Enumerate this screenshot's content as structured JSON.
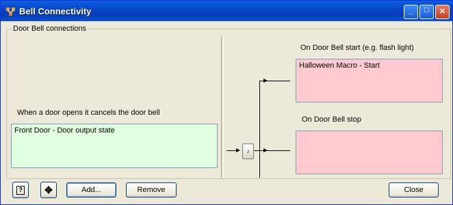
{
  "window": {
    "title": "Bell Connectivity",
    "minimize_glyph": "_",
    "maximize_glyph": "□",
    "close_glyph": "✕"
  },
  "group": {
    "label": "Door Bell connections"
  },
  "left": {
    "cancel_label": "When a door opens it cancels the door bell",
    "input_item": "Front Door - Door output state"
  },
  "right": {
    "start_label": "On Door Bell start (e.g. flash light)",
    "start_item": "Halloween Macro - Start",
    "stop_label": "On Door Bell stop",
    "stop_item": ""
  },
  "icons": {
    "app": "bell-connectivity-app-icon",
    "help": "help-icon",
    "settings": "settings-icon",
    "gate": "gate-node-icon"
  },
  "buttons": {
    "add": "Add...",
    "remove": "Remove",
    "close": "Close",
    "help_glyph": "?",
    "settings_glyph": "✥",
    "gate_glyph": "♪"
  },
  "colors": {
    "input_box": "#e0ffe0",
    "output_box": "#ffcad0",
    "titlebar": "#0a52d6"
  }
}
